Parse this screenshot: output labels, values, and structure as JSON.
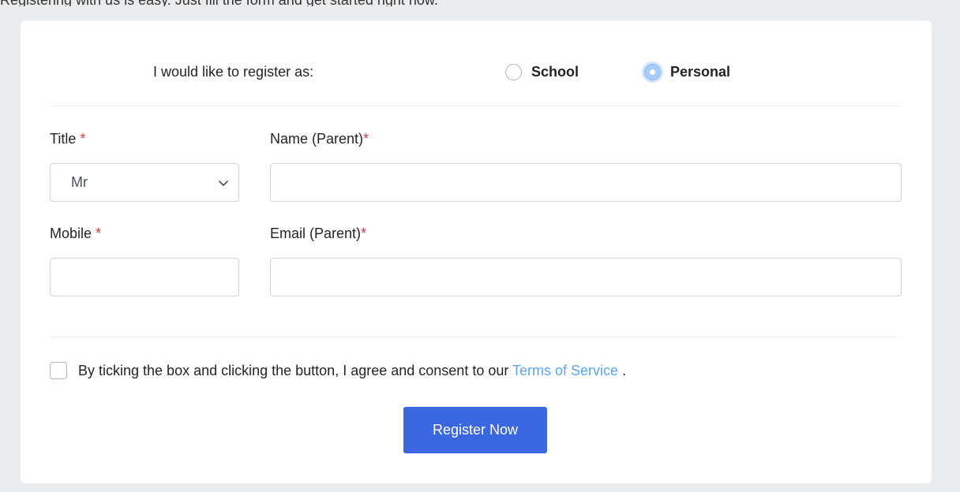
{
  "page": {
    "top_text": "Registering with us is easy. Just fill the form and get started right now."
  },
  "registration": {
    "register_as_label": "I would like to register as:",
    "options": [
      {
        "label": "School",
        "checked": false
      },
      {
        "label": "Personal",
        "checked": true
      }
    ]
  },
  "form": {
    "title_label": "Title",
    "title_value": "Mr",
    "name_label": "Name (Parent)",
    "name_value": "",
    "mobile_label": "Mobile",
    "mobile_value": "",
    "email_label": "Email (Parent)",
    "email_value": "",
    "required_marker": "*"
  },
  "consent": {
    "text": "By ticking the box and clicking the button, I agree and consent to our",
    "link_text": "Terms of Service",
    "suffix": "."
  },
  "actions": {
    "register_label": "Register Now"
  },
  "colors": {
    "accent": "#3b68e0",
    "link": "#5ba4f0",
    "required": "#dc3545",
    "background": "#e9ecef"
  }
}
